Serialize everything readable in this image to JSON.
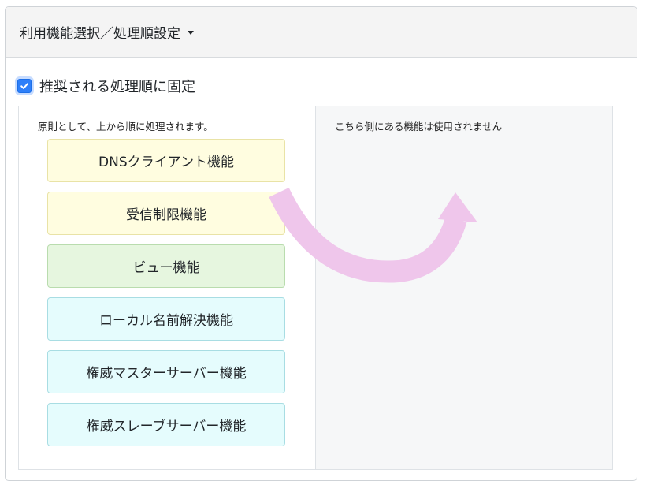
{
  "header": {
    "title": "利用機能選択／処理順設定"
  },
  "fixed_order": {
    "label": "推奨される処理順に固定",
    "checked": true
  },
  "left_panel": {
    "note": "原則として、上から順に処理されます。",
    "items": [
      {
        "label": "DNSクライアント機能",
        "color": "yellow"
      },
      {
        "label": "受信制限機能",
        "color": "yellow"
      },
      {
        "label": "ビュー機能",
        "color": "green"
      },
      {
        "label": "ローカル名前解決機能",
        "color": "cyan"
      },
      {
        "label": "権威マスターサーバー機能",
        "color": "cyan"
      },
      {
        "label": "権威スレーブサーバー機能",
        "color": "cyan"
      }
    ]
  },
  "right_panel": {
    "note": "こちら側にある機能は使用されません"
  },
  "colors": {
    "accent": "#2d7ff9",
    "arrow": "#efc6eb"
  }
}
